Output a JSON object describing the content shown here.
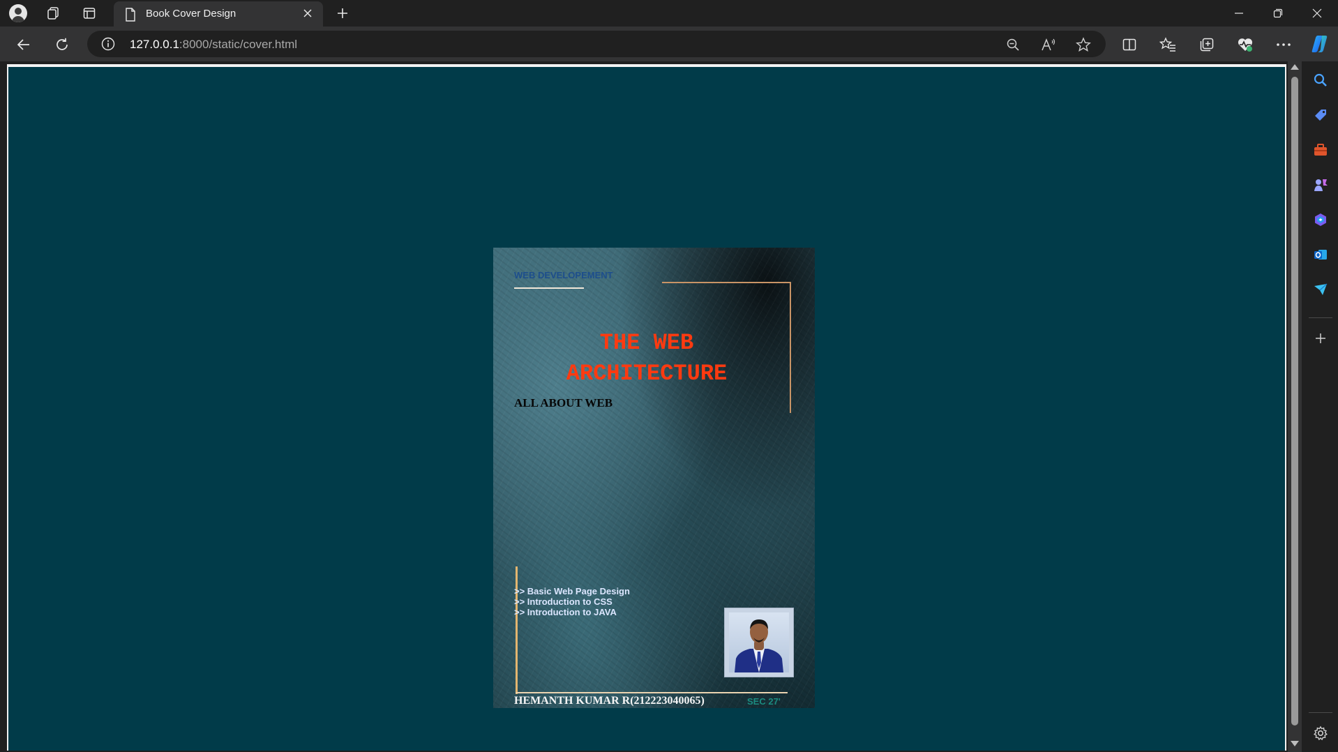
{
  "browser": {
    "tab": {
      "title": "Book Cover Design"
    },
    "address": {
      "host": "127.0.0.1",
      "path": ":8000/static/cover.html"
    }
  },
  "colors": {
    "page_background": "#013b49",
    "title_color": "#ff3a10",
    "genre_color": "#1d4e8c",
    "frame_accent": "#c99466",
    "section_color": "#1b8b80"
  },
  "icons": {
    "tabstrip": [
      "profile-avatar-icon",
      "workspaces-icon",
      "tab-actions-icon",
      "page-icon",
      "close-icon",
      "new-tab-icon"
    ],
    "window": [
      "minimize-icon",
      "restore-icon",
      "close-window-icon"
    ],
    "toolbar": [
      "back-icon",
      "refresh-icon",
      "info-icon",
      "zoom-out-icon",
      "read-aloud-icon",
      "favorite-star-icon",
      "split-screen-icon",
      "favorites-icon",
      "collections-icon",
      "browser-essentials-icon",
      "more-icon",
      "copilot-icon"
    ],
    "sidebar": [
      "search-icon",
      "shopping-tag-icon",
      "tools-icon",
      "games-icon",
      "microsoft-365-icon",
      "outlook-icon",
      "send-icon",
      "add-icon",
      "settings-icon"
    ]
  },
  "cover": {
    "genre": "WEB DEVELOPEMENT",
    "title_line1": "THE WEB",
    "title_line2": "ARCHITECTURE",
    "subtitle": "ALL ABOUT WEB",
    "topics": [
      ">> Basic Web Page Design",
      ">> Introduction to CSS",
      ">> Introduction to JAVA"
    ],
    "author": "HEMANTH KUMAR R(212223040065)",
    "section": "SEC 27'"
  }
}
